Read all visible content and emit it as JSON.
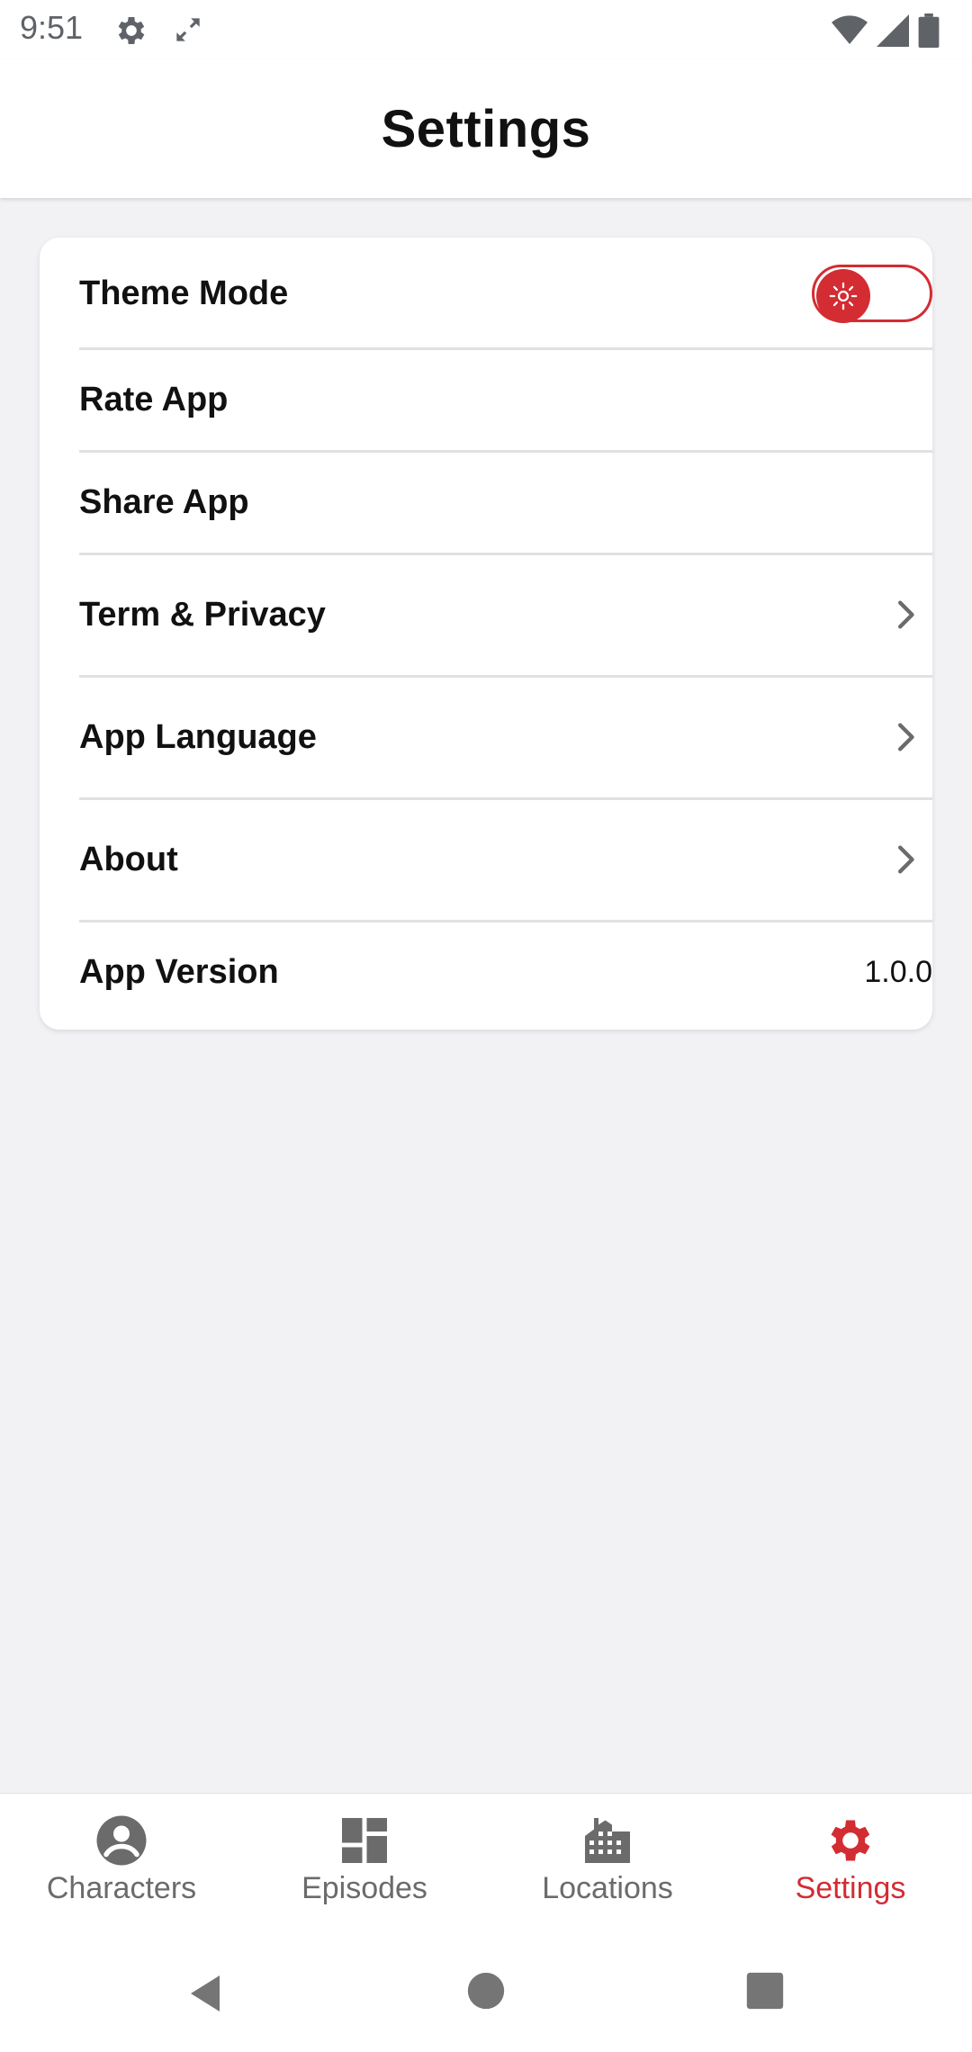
{
  "status_bar": {
    "time": "9:51",
    "icons": [
      "gear-icon",
      "expand-icon",
      "wifi-icon",
      "signal-icon",
      "battery-icon"
    ]
  },
  "header": {
    "title": "Settings"
  },
  "settings": {
    "items": [
      {
        "label": "Theme Mode",
        "control": "toggle"
      },
      {
        "label": "Rate App"
      },
      {
        "label": "Share App"
      },
      {
        "label": "Term & Privacy",
        "control": "chevron"
      },
      {
        "label": "App Language",
        "control": "chevron"
      },
      {
        "label": "About",
        "control": "chevron"
      },
      {
        "label": "App Version",
        "value": "1.0.0"
      }
    ]
  },
  "bottom_nav": {
    "items": [
      {
        "label": "Characters",
        "icon": "account-circle-icon",
        "active": false
      },
      {
        "label": "Episodes",
        "icon": "dashboard-icon",
        "active": false
      },
      {
        "label": "Locations",
        "icon": "city-icon",
        "active": false
      },
      {
        "label": "Settings",
        "icon": "gear-icon",
        "active": true
      }
    ]
  },
  "colors": {
    "accent": "#d32c33",
    "background": "#f2f1f4",
    "card": "#ffffff",
    "inactive": "#6b6b6b"
  }
}
